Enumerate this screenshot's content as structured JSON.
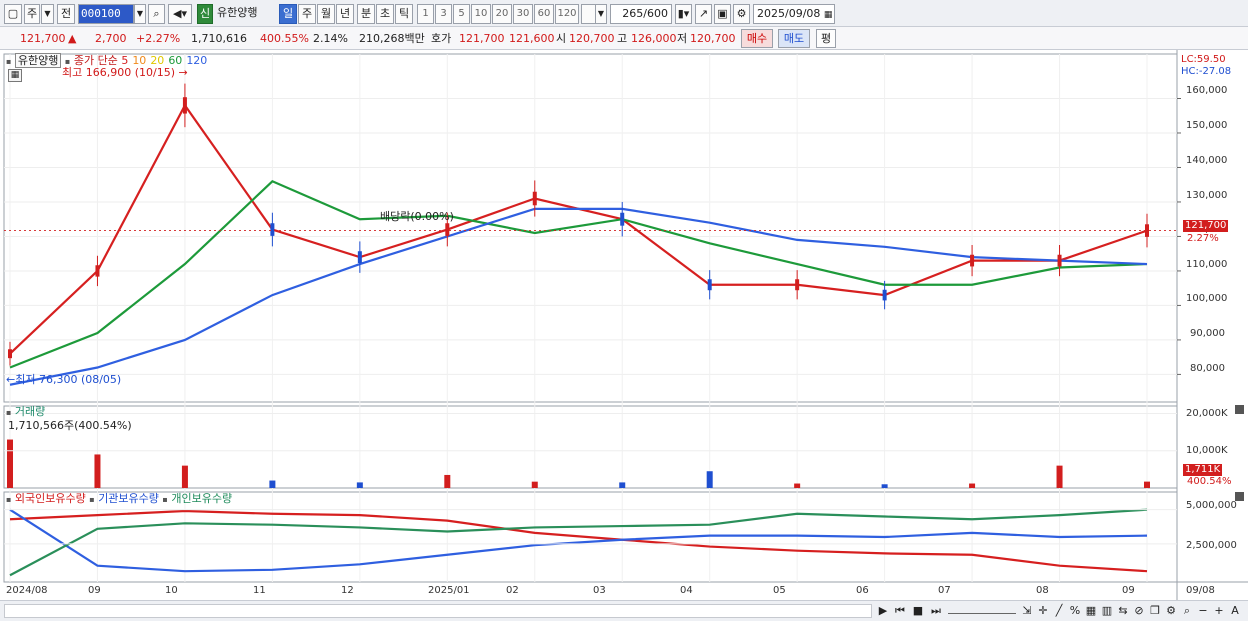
{
  "toolbar": {
    "market_label": "주",
    "prev_label": "전",
    "code_value": "000100",
    "corp_tag": "신",
    "stock_name": "유한양행",
    "periods": [
      "일",
      "주",
      "월",
      "년",
      "분",
      "초",
      "틱"
    ],
    "selected_period": "일",
    "intervals": [
      "1",
      "3",
      "5",
      "10",
      "20",
      "30",
      "60",
      "120"
    ],
    "count_value": "265",
    "count_max": "/600",
    "date_value": "2025/09/08"
  },
  "quote": {
    "price": "121,700",
    "change_arrow": "▲",
    "change": "2,700",
    "change_pct": "+2.27%",
    "volume": "1,710,616",
    "volume_ratio": "400.55%",
    "turnover_pct": "2.14%",
    "amount": "210,268백만",
    "bid_label": "호가",
    "bid1": "121,700",
    "bid2": "121,600",
    "open_label": "시",
    "open": "120,700",
    "high_label": "고",
    "high": "126,000",
    "low_label": "저",
    "low": "120,700",
    "buy_label": "매수",
    "sell_label": "매도",
    "avg_label": "평"
  },
  "price_panel": {
    "name": "유한양행",
    "legend_title": "종가 단순",
    "ma_periods": [
      "5",
      "10",
      "20",
      "60",
      "120"
    ],
    "ma_colors": [
      "#d62020",
      "#f08a1c",
      "#f2e21b",
      "#1d9a3a",
      "#2f5fe0"
    ],
    "high_note": "최고 166,900 (10/15)",
    "low_note": "최저 76,300 (08/05)",
    "dividend_note": "배당락(0.00%)",
    "lc": "LC:59.50",
    "hc": "HC:-27.08",
    "last_price_tag": "121,700",
    "last_pct_tag": "2.27%",
    "y_ticks": [
      "160,000",
      "150,000",
      "140,000",
      "130,000",
      "120,000",
      "110,000",
      "100,000",
      "90,000",
      "80,000"
    ]
  },
  "volume_panel": {
    "name": "거래량",
    "note": "1,710,566주(400.54%)",
    "y_ticks": [
      "20,000K",
      "10,000K"
    ],
    "last_tag": "1,711K",
    "last_pct": "400.54%"
  },
  "holding_panel": {
    "series_names": [
      "외국인보유수량",
      "기관보유수량",
      "개인보유수량"
    ],
    "y_ticks": [
      "5,000,000",
      "2,500,000"
    ]
  },
  "x_axis": [
    "2024/08",
    "09",
    "10",
    "11",
    "12",
    "2025/01",
    "02",
    "03",
    "04",
    "05",
    "06",
    "07",
    "08",
    "09",
    "09/08"
  ],
  "chart_data": [
    {
      "type": "line",
      "title": "유한양행",
      "y_unit": "KRW",
      "ylim": [
        72000,
        170000
      ],
      "x": [
        "2024/08",
        "09",
        "10",
        "11",
        "12",
        "2025/01",
        "02",
        "03",
        "04",
        "05",
        "06",
        "07",
        "08",
        "09"
      ],
      "series": [
        {
          "name": "5",
          "values": [
            86000,
            110000,
            158000,
            122000,
            114000,
            122000,
            131000,
            125000,
            106000,
            106000,
            103000,
            113000,
            113000,
            121700
          ]
        },
        {
          "name": "60",
          "values": [
            82000,
            92000,
            112000,
            136000,
            125000,
            126000,
            121000,
            125000,
            118000,
            112000,
            106000,
            106000,
            111000,
            112000
          ]
        },
        {
          "name": "120",
          "values": [
            77000,
            82000,
            90000,
            103000,
            112000,
            120000,
            128000,
            128000,
            124000,
            119000,
            117000,
            114000,
            113000,
            112000
          ]
        }
      ]
    },
    {
      "type": "bar",
      "title": "거래량",
      "x": [
        "2024/08",
        "09",
        "10",
        "11",
        "12",
        "2025/01",
        "02",
        "03",
        "04",
        "05",
        "06",
        "07",
        "08",
        "09"
      ],
      "values_k": [
        13000,
        9000,
        6000,
        2000,
        1500,
        3500,
        1700,
        1500,
        4500,
        1200,
        1000,
        1200,
        6000,
        1711
      ],
      "ylim": [
        0,
        22000
      ]
    },
    {
      "type": "line",
      "title": "보유수량",
      "x": [
        "2024/08",
        "09",
        "10",
        "11",
        "12",
        "2025/01",
        "02",
        "03",
        "04",
        "05",
        "06",
        "07",
        "08",
        "09"
      ],
      "series": [
        {
          "name": "외국인보유수량",
          "values": [
            4300000,
            4600000,
            4900000,
            4700000,
            4600000,
            4200000,
            3300000,
            2800000,
            2300000,
            2000000,
            1800000,
            1700000,
            900000,
            500000
          ]
        },
        {
          "name": "기관보유수량",
          "values": [
            5000000,
            900000,
            500000,
            600000,
            1000000,
            1700000,
            2400000,
            2800000,
            3100000,
            3100000,
            3000000,
            3300000,
            3000000,
            3100000
          ]
        },
        {
          "name": "개인보유수량",
          "values": [
            200000,
            3600000,
            4000000,
            3900000,
            3700000,
            3400000,
            3700000,
            3800000,
            3900000,
            4700000,
            4500000,
            4300000,
            4600000,
            5000000
          ]
        }
      ],
      "ylim": [
        0,
        6000000
      ]
    }
  ]
}
